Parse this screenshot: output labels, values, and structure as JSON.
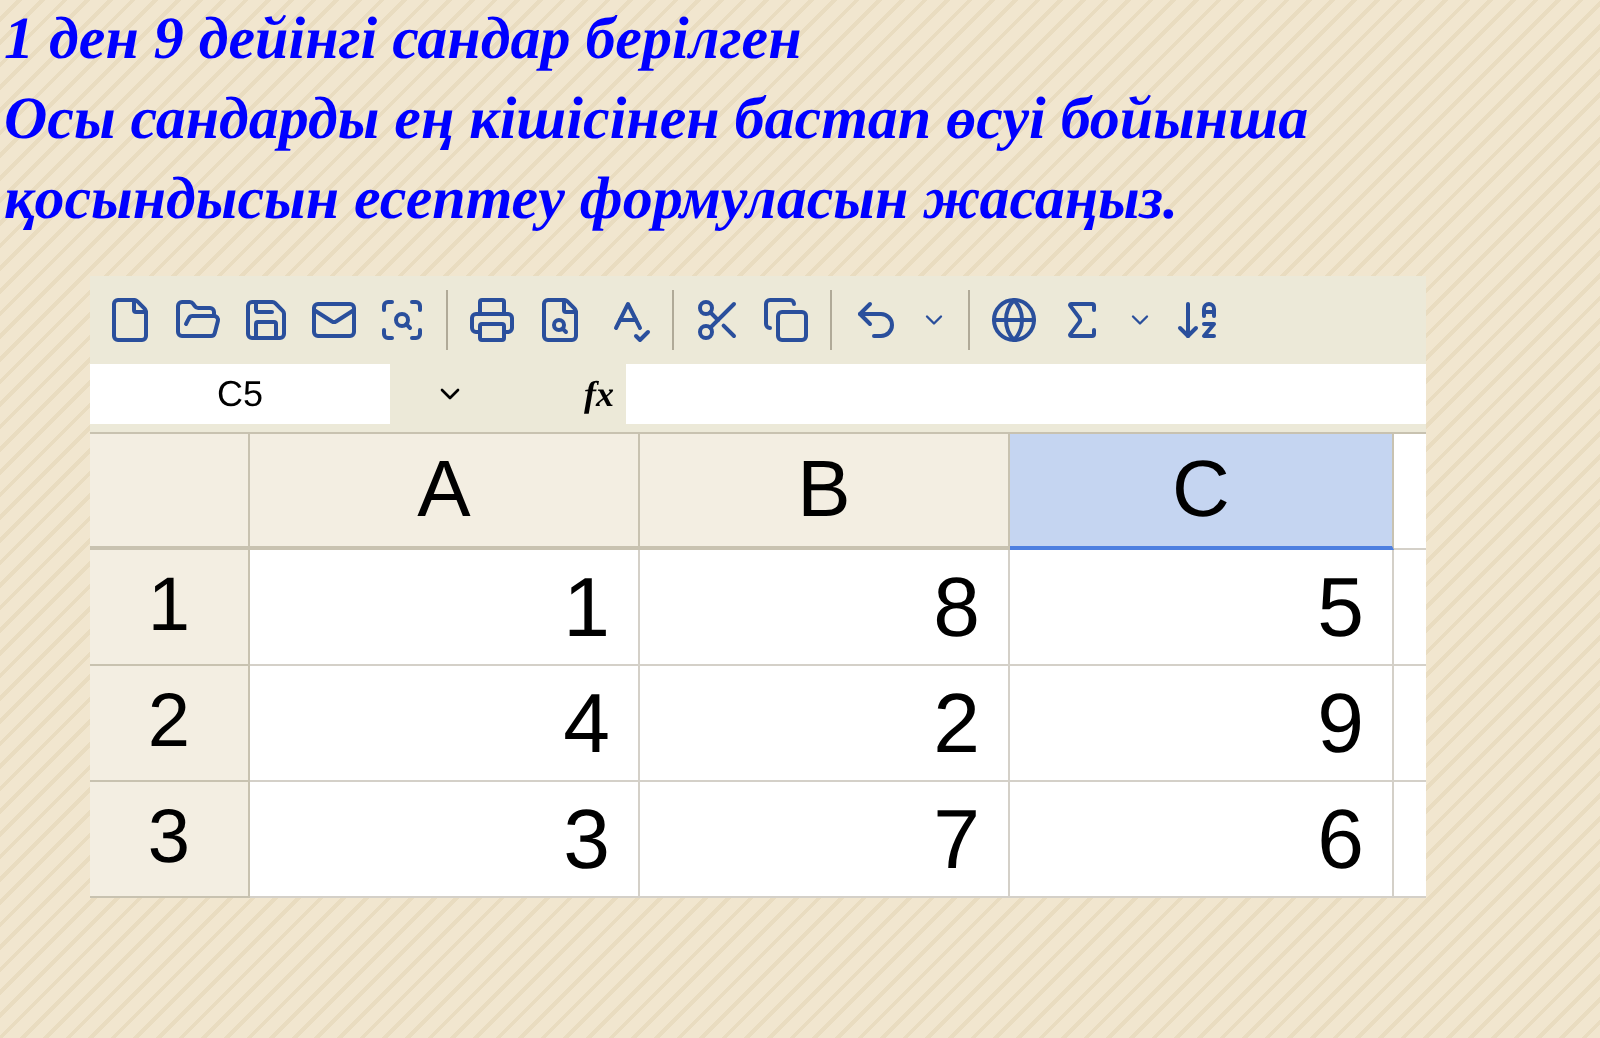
{
  "heading": "1 ден 9 дейінгі сандар берілген",
  "task": "Осы сандарды ең кішісінен бастап өсуі бойынша қосындысын есептеу формуласын жасаңыз.",
  "spreadsheet": {
    "name_box": "C5",
    "formula_label": "fx",
    "columns": [
      {
        "label": "A",
        "selected": false
      },
      {
        "label": "B",
        "selected": false
      },
      {
        "label": "C",
        "selected": true
      }
    ],
    "rows": [
      {
        "label": "1",
        "cells": [
          "1",
          "8",
          "5"
        ]
      },
      {
        "label": "2",
        "cells": [
          "4",
          "2",
          "9"
        ]
      },
      {
        "label": "3",
        "cells": [
          "3",
          "7",
          "6"
        ]
      }
    ]
  }
}
